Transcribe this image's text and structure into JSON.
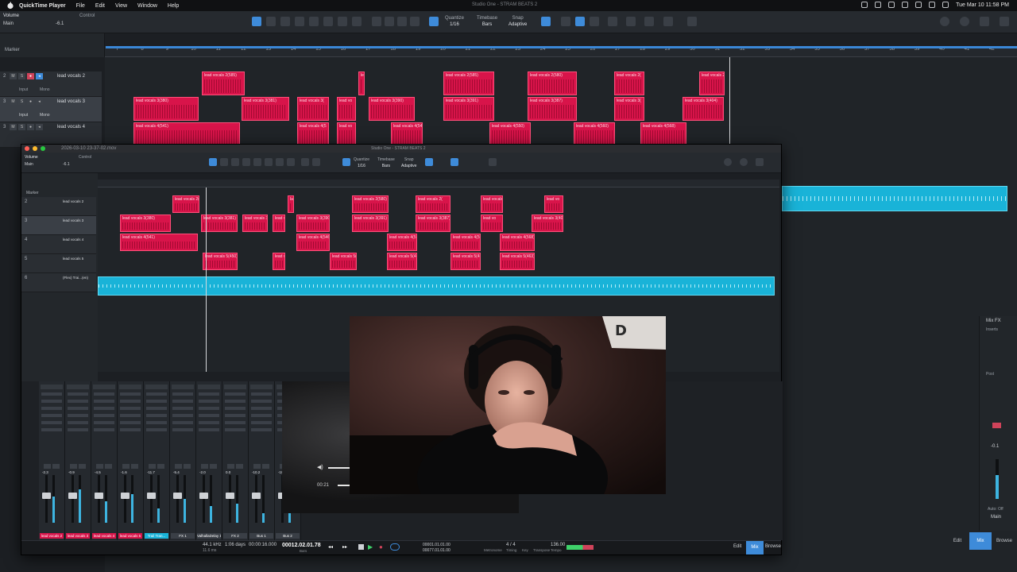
{
  "menubar": {
    "app": "QuickTime Player",
    "items": [
      "File",
      "Edit",
      "View",
      "Window",
      "Help"
    ],
    "window_title": "Studio One - STRAM BEATS 2",
    "clock": "Tue Mar 10  11:58 PM"
  },
  "back_window": {
    "inspector": {
      "channel": "Volume",
      "control": "Control",
      "main": "Main",
      "value": "-6.1"
    },
    "toolbar": {
      "quantize_label": "Quantize",
      "quantize_value": "1/16",
      "timebase_label": "Timebase",
      "timebase_value": "Bars",
      "snap_label": "Snap",
      "snap_value": "Adaptive"
    },
    "marker_label": "Marker",
    "ruler_ticks": [
      "7",
      "8",
      "9",
      "10",
      "11",
      "12",
      "13",
      "14",
      "15",
      "16",
      "17",
      "18",
      "19",
      "20",
      "21",
      "22",
      "23",
      "24",
      "25",
      "26",
      "27",
      "28",
      "29",
      "30",
      "31",
      "32",
      "33",
      "34",
      "35",
      "36",
      "37",
      "38",
      "39",
      "40",
      "41",
      "42"
    ],
    "tracks": [
      {
        "num": "2",
        "name": "lead vocals 2"
      },
      {
        "num": "3",
        "name": "lead vocals 3"
      },
      {
        "num": "3",
        "name": "lead vocals 4"
      }
    ],
    "track_io": {
      "input": "Input",
      "mode": "Mono"
    },
    "clips_row1": [
      "lead vocals 2(585)",
      "le",
      "lead vocals 2(585)",
      "lead vocals 2(580)",
      "lead vocals 2(",
      "lead vocals 2("
    ],
    "clips_row2": [
      "lead vocals 3(380)",
      "lead vocals 3(381)",
      "lead vocals 3(",
      "lead vo",
      "lead vocals 3(390)",
      "lead vocals 3(391)",
      "lead vocals 3(387)",
      "lead vocals 3(",
      "lead vocals 3(404)"
    ],
    "clips_row3": [
      "lead vocals 4(541)",
      "lead vocals 4(5",
      "lead vo",
      "lead vocals 4(546)",
      "lead vocals 4(550)",
      "lead vocals 4(560)",
      "lead vocals 4(568)"
    ],
    "right_panel": {
      "mix_fx": "Mix FX",
      "inserts": "Inserts",
      "post": "Post",
      "value": "-0.1",
      "auto": "Auto: Off",
      "main": "Main"
    },
    "bottom_tabs": {
      "edit": "Edit",
      "mix": "Mix",
      "browse": "Browse"
    }
  },
  "front_window": {
    "title": "Studio One - STRAM BEATS 2",
    "file": "2026-03-10 23-37-02.mov",
    "inspector": {
      "channel": "Volume",
      "control": "Control",
      "main": "Main",
      "value": "-6.1"
    },
    "toolbar": {
      "quantize_label": "Quantize",
      "quantize_value": "1/16",
      "timebase_label": "Timebase",
      "timebase_value": "Bars",
      "snap_label": "Snap",
      "snap_value": "Adaptive"
    },
    "marker_label": "Marker",
    "tracks": [
      {
        "num": "2",
        "name": "lead vocals 2"
      },
      {
        "num": "3",
        "name": "lead vocals 3"
      },
      {
        "num": "4",
        "name": "lead vocals 4"
      },
      {
        "num": "5",
        "name": "lead vocals 5"
      },
      {
        "num": "6",
        "name": "(Flex) Trai...(en)"
      }
    ],
    "clips_row1": [
      "lead vocals 2(",
      "la",
      "lead vocals 2(580)",
      "lead vocals 2(",
      "lead vocals 2(",
      "lead vo"
    ],
    "clips_row2": [
      "lead vocals 3(380)",
      "lead vocals 3(381)",
      "lead vocals 3(",
      "lead vo",
      "lead vocals 3(390)",
      "lead vocals 3(391)",
      "lead vocals 3(387)",
      "lead vo",
      "lead vocals 3(404)"
    ],
    "clips_row3": [
      "lead vocals 4(541)",
      "lead vocals 4(546)",
      "lead vocals 4(550)",
      "lead vocals 4(560)",
      "lead vocals 4(568)"
    ],
    "clips_row4": [
      "lead vocals 5(450)",
      "lead vo",
      "lead vocals 5(442)",
      "lead vocals 5(446)",
      "lead vocals 5(457)",
      "lead vocals 5(463)"
    ],
    "mixer_strips": [
      {
        "name": "lead vocals 2",
        "value": "-2.3"
      },
      {
        "name": "lead vocals 3",
        "value": "-0.9"
      },
      {
        "name": "lead vocals 4",
        "value": "-4.5"
      },
      {
        "name": "lead vocals 5",
        "value": "-1.6"
      },
      {
        "name": "Trail Tran...",
        "value": "-11.7"
      },
      {
        "name": "FX 1",
        "value": "-5.4"
      },
      {
        "name": "ValhallaDelay 1",
        "value": "-2.0"
      },
      {
        "name": "FX 2",
        "value": "0.0"
      },
      {
        "name": "Bus 1",
        "value": "-10.2"
      },
      {
        "name": "Bus 2",
        "value": "-10.2"
      }
    ],
    "transport": {
      "sample_rate": "44.1 kHz",
      "latency": "11.6 ms",
      "record_max": "1:06 days",
      "seconds": "00:00:16.000",
      "position": "00012.02.01.78",
      "bars_label": "Bars",
      "loop_start": "00001.01.01.00",
      "loop_end": "00077.01.01.00",
      "signature": "4 / 4",
      "tempo": "136.00",
      "tempo_label": "Tempo",
      "timing_label": "Timing",
      "metronome_label": "Metronome",
      "key_label": "Key",
      "transpose_label": "Transpose"
    },
    "bottom_tabs": {
      "edit": "Edit",
      "mix": "Mix",
      "browse": "Browse"
    }
  },
  "quicktime": {
    "elapsed": "00:21"
  },
  "colors": {
    "clip": "#d8144a",
    "audio": "#19b3d8",
    "accent": "#3e8bd9"
  }
}
